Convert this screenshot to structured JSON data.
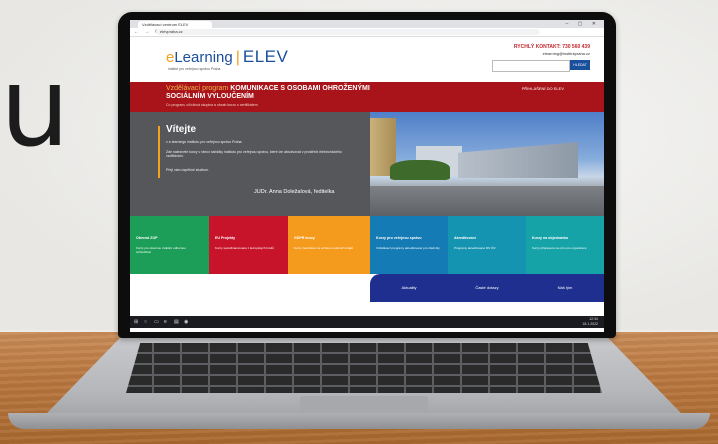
{
  "scene": {
    "big_letter": "u"
  },
  "browser": {
    "tab_title": "Vzdělávací centrum ELEV",
    "url": "elevpraha.cz",
    "nav_glyphs": "← → ⟳",
    "window_buttons": "– ▢ ✕"
  },
  "site": {
    "logo_e": "e",
    "logo_learning": "Learning",
    "logo_separator": "|",
    "logo_elev": "ELEV",
    "logo_sub": "institut pro veřejnou správu Praha",
    "contact": "RYCHLÝ KONTAKT: 730 560 439",
    "email": "elearning@institutpraha.cz",
    "search_button": "HLEDAT",
    "search_placeholder": ""
  },
  "banner": {
    "program_prefix": "Vzdělávací program",
    "program_title_1": "KOMUNIKACE S OSOBAMI OHROŽENÝMI",
    "program_title_2": "SOCIÁLNÍM VYLOUČENÍM",
    "description": "Co program, cíl/cílová skupina a obsah kurzu s certifikátem",
    "login": "PŘIHLÁŠENÍ DO ELEV"
  },
  "hero": {
    "heading": "Vítejte",
    "intro": "v e-learningu institutu pro veřejnou správu Praha.",
    "p1": "Zde naleznete kurzy v rámci nabídky institutu pro veřejnou správu, které lze absolvovat v prostředí elektronického vzdělávání.",
    "p2": "Přeji vám úspěšné studium.",
    "signature": "JUDr. Anna Doležalová, ředitelka"
  },
  "tiles": [
    {
      "title": "Obecná ZOP",
      "desc": "Kurzy pro obecnou zvláštní odbornou způsobilost",
      "color": "#1d9e58"
    },
    {
      "title": "EU Projekty",
      "desc": "Kurzy spolufinancované z Evropských fondů",
      "color": "#c8142b"
    },
    {
      "title": "GDPR kurzy",
      "desc": "Kurzy zaměřené na ochranu osobních údajů",
      "color": "#f49b1e"
    },
    {
      "title": "Kurzy pro veřejnou správu",
      "desc": "Vzdělávací programy akreditované pro úředníky",
      "color": "#147bb5"
    },
    {
      "title": "Akreditovaní",
      "desc": "Programy akreditované MV ČR",
      "color": "#1494b0"
    },
    {
      "title": "Kurzy na objednávku",
      "desc": "Kurzy připravené na míru pro organizace",
      "color": "#15a3a8"
    }
  ],
  "bottom_buttons": [
    {
      "label": "Aktuality"
    },
    {
      "label": "Časté dotazy"
    },
    {
      "label": "Náš tým"
    }
  ],
  "taskbar": {
    "time": "12:34",
    "date": "18.1.2022"
  }
}
